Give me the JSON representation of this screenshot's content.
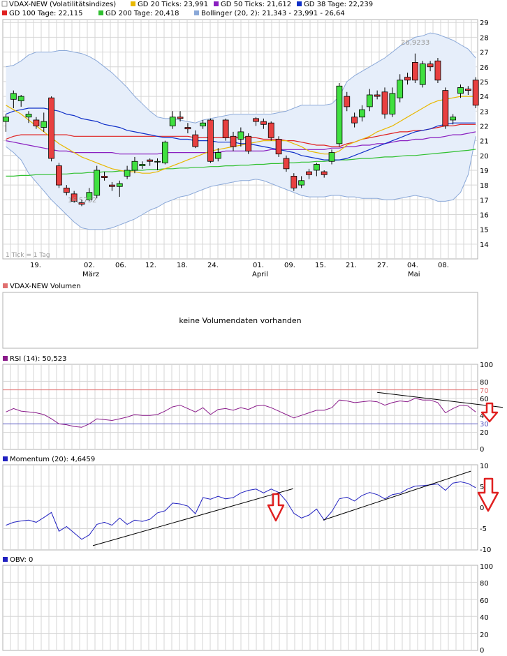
{
  "colors": {
    "ma20": "#e8b800",
    "ma50": "#8a1fc0",
    "ma38": "#1030c8",
    "ma100": "#e02020",
    "ma200": "#30c030",
    "bollinger": "#8aa8d8",
    "bollinger_fill": "#e6eefa",
    "up_candle": "#40e040",
    "down_candle": "#e84040",
    "rsi": "#8a1a8a",
    "rsi70": "#e07070",
    "rsi30": "#5050c0",
    "momentum": "#2020c0",
    "trend": "#000000",
    "arrow": "#e02020",
    "grid": "#cfcfcf",
    "frame": "#b0b0b0"
  },
  "legend": {
    "row1": [
      {
        "label": "VDAX-NEW (Volatilitätsindizes)",
        "color": "#ffffff"
      },
      {
        "label": "GD 20 Ticks: 23,991",
        "color": "#e8b800"
      },
      {
        "label": "GD 50 Ticks: 21,612",
        "color": "#8a1fc0"
      },
      {
        "label": "GD 38 Tage: 22,239",
        "color": "#1030c8"
      }
    ],
    "row2": [
      {
        "label": "GD 100 Tage: 22,115",
        "color": "#e02020"
      },
      {
        "label": "GD 200 Tage: 20,418",
        "color": "#30c030"
      },
      {
        "label": "Bollinger (20, 2): 21,343 - 23,991 - 26,64",
        "color": "#8aa8d8"
      }
    ]
  },
  "tick_note": "1 Tick = 1 Tag",
  "x_axis": {
    "day_labels": [
      "19.",
      "02.",
      "06.",
      "12.",
      "18.",
      "24.",
      "01.",
      "09.",
      "15.",
      "21.",
      "27.",
      "04.",
      "08."
    ],
    "month_labels": [
      "März",
      "April",
      "Mai"
    ]
  },
  "volume_panel": {
    "title": "VDAX-NEW Volumen",
    "message": "keine Volumendaten vorhanden"
  },
  "rsi_panel": {
    "title": "RSI (14): 50,523",
    "y_ticks": [
      "100",
      "80",
      "70",
      "60",
      "40",
      "30",
      "20",
      "0"
    ]
  },
  "momentum_panel": {
    "title": "Momentum (20): 4,6459",
    "y_ticks": [
      "10",
      "5",
      "0",
      "-5",
      "-10"
    ]
  },
  "obv_panel": {
    "title": "OBV: 0",
    "y_ticks": [
      "100",
      "80",
      "60",
      "40",
      "20",
      "0"
    ]
  },
  "chart_data": {
    "type": "candlestick",
    "main": {
      "ylim": [
        13,
        29.2
      ],
      "y_ticks": [
        14,
        15,
        16,
        17,
        18,
        19,
        20,
        21,
        22,
        23,
        24,
        25,
        26,
        27,
        28,
        29
      ],
      "annotations": [
        {
          "text": "26,9233",
          "value": 26.9233,
          "at_index": 49
        },
        {
          "text": "16,5732",
          "value": 16.5732,
          "at_index": 9
        }
      ],
      "candles": [
        [
          22.3,
          22.6,
          21.6,
          22.8
        ],
        [
          23.8,
          24.2,
          23.2,
          24.4
        ],
        [
          23.7,
          24.0,
          23.3,
          24.1
        ],
        [
          22.6,
          22.8,
          22.2,
          23.0
        ],
        [
          22.4,
          22.0,
          21.8,
          22.6
        ],
        [
          21.9,
          22.3,
          21.6,
          22.9
        ],
        [
          23.9,
          19.8,
          19.6,
          24.0
        ],
        [
          19.3,
          18.0,
          17.8,
          19.5
        ],
        [
          17.8,
          17.5,
          17.3,
          18.0
        ],
        [
          17.4,
          16.9,
          16.8,
          17.6
        ],
        [
          16.8,
          16.7,
          16.57,
          17.0
        ],
        [
          17.0,
          17.5,
          16.9,
          17.8
        ],
        [
          17.3,
          19.0,
          17.1,
          19.3
        ],
        [
          18.6,
          18.5,
          18.3,
          18.9
        ],
        [
          18.0,
          17.9,
          17.6,
          18.2
        ],
        [
          17.9,
          18.1,
          17.2,
          18.3
        ],
        [
          18.6,
          19.0,
          18.4,
          19.3
        ],
        [
          19.0,
          19.6,
          18.8,
          19.9
        ],
        [
          19.3,
          19.4,
          19.1,
          19.6
        ],
        [
          19.7,
          19.6,
          19.3,
          19.8
        ],
        [
          19.6,
          19.6,
          19.0,
          19.8
        ],
        [
          19.5,
          20.9,
          19.4,
          21.0
        ],
        [
          22.0,
          22.6,
          21.8,
          23.0
        ],
        [
          22.6,
          22.5,
          22.3,
          23.0
        ],
        [
          21.9,
          21.8,
          21.5,
          22.2
        ],
        [
          21.4,
          20.6,
          20.5,
          21.7
        ],
        [
          22.0,
          22.2,
          21.8,
          22.4
        ],
        [
          22.4,
          19.6,
          19.5,
          22.5
        ],
        [
          19.8,
          20.2,
          19.6,
          20.5
        ],
        [
          22.4,
          21.2,
          21.0,
          22.5
        ],
        [
          21.3,
          20.6,
          20.3,
          21.6
        ],
        [
          21.1,
          21.6,
          20.6,
          21.9
        ],
        [
          21.3,
          20.3,
          20.1,
          21.5
        ],
        [
          22.5,
          22.3,
          22.0,
          22.6
        ],
        [
          22.3,
          22.1,
          21.8,
          22.5
        ],
        [
          22.2,
          21.2,
          21.0,
          22.3
        ],
        [
          21.1,
          20.1,
          19.9,
          21.3
        ],
        [
          19.8,
          19.1,
          18.9,
          20.0
        ],
        [
          18.6,
          17.8,
          17.6,
          18.8
        ],
        [
          18.0,
          18.3,
          17.8,
          18.6
        ],
        [
          18.9,
          18.7,
          18.4,
          19.1
        ],
        [
          19.0,
          19.4,
          18.6,
          19.5
        ],
        [
          18.9,
          18.7,
          18.5,
          19.0
        ],
        [
          19.6,
          20.2,
          19.4,
          20.4
        ],
        [
          20.8,
          24.7,
          20.6,
          24.9
        ],
        [
          24.0,
          23.3,
          23.0,
          24.3
        ],
        [
          22.6,
          22.2,
          21.9,
          22.9
        ],
        [
          22.6,
          23.1,
          22.3,
          23.4
        ],
        [
          23.3,
          24.1,
          23.0,
          24.5
        ],
        [
          24.1,
          24.0,
          23.8,
          24.4
        ],
        [
          24.3,
          22.8,
          22.5,
          24.6
        ],
        [
          22.8,
          24.2,
          22.6,
          24.6
        ],
        [
          23.9,
          25.1,
          23.6,
          25.5
        ],
        [
          25.3,
          25.1,
          24.8,
          25.6
        ],
        [
          26.3,
          25.1,
          24.9,
          26.9
        ],
        [
          24.8,
          26.2,
          24.6,
          26.4
        ],
        [
          26.2,
          26.0,
          25.7,
          26.4
        ],
        [
          26.4,
          25.1,
          24.9,
          26.6
        ],
        [
          24.4,
          22.0,
          21.8,
          24.6
        ],
        [
          22.4,
          22.6,
          22.1,
          22.8
        ],
        [
          24.2,
          24.6,
          23.9,
          24.8
        ],
        [
          24.5,
          24.4,
          24.1,
          24.7
        ],
        [
          25.1,
          23.4,
          23.2,
          25.3
        ]
      ],
      "series": [
        {
          "name": "GD 20 Ticks",
          "values": [
            23.4,
            23.1,
            22.8,
            22.4,
            22.0,
            21.6,
            21.2,
            20.8,
            20.5,
            20.2,
            19.9,
            19.7,
            19.5,
            19.3,
            19.1,
            19.0,
            18.9,
            18.9,
            18.8,
            18.8,
            18.9,
            19.1,
            19.3,
            19.5,
            19.7,
            19.9,
            20.1,
            20.3,
            20.4,
            20.5,
            20.6,
            20.7,
            20.8,
            20.9,
            21.0,
            21.0,
            21.0,
            21.0,
            20.8,
            20.6,
            20.3,
            20.2,
            20.1,
            20.1,
            20.3,
            20.7,
            20.9,
            21.1,
            21.3,
            21.6,
            21.8,
            22.0,
            22.3,
            22.6,
            22.9,
            23.2,
            23.5,
            23.7,
            23.8,
            23.9,
            24.0,
            24.0,
            24.0
          ]
        },
        {
          "name": "GD 50 Ticks",
          "values": [
            21.0,
            20.9,
            20.8,
            20.7,
            20.6,
            20.5,
            20.4,
            20.3,
            20.3,
            20.2,
            20.2,
            20.2,
            20.2,
            20.2,
            20.2,
            20.1,
            20.1,
            20.1,
            20.1,
            20.1,
            20.1,
            20.2,
            20.2,
            20.2,
            20.2,
            20.2,
            20.2,
            20.2,
            20.2,
            20.3,
            20.3,
            20.3,
            20.3,
            20.3,
            20.3,
            20.4,
            20.4,
            20.4,
            20.4,
            20.4,
            20.4,
            20.4,
            20.4,
            20.5,
            20.5,
            20.6,
            20.6,
            20.7,
            20.7,
            20.8,
            20.8,
            20.9,
            21.0,
            21.0,
            21.1,
            21.1,
            21.2,
            21.2,
            21.3,
            21.4,
            21.4,
            21.5,
            21.6
          ]
        },
        {
          "name": "GD 38 Tage",
          "values": [
            22.8,
            23.0,
            23.1,
            23.2,
            23.2,
            23.2,
            23.1,
            23.0,
            22.8,
            22.7,
            22.5,
            22.4,
            22.3,
            22.1,
            22.0,
            21.9,
            21.7,
            21.6,
            21.5,
            21.4,
            21.3,
            21.2,
            21.2,
            21.1,
            21.1,
            21.0,
            21.0,
            21.0,
            20.9,
            20.9,
            20.9,
            20.8,
            20.8,
            20.7,
            20.6,
            20.5,
            20.4,
            20.3,
            20.2,
            20.0,
            19.9,
            19.8,
            19.7,
            19.7,
            19.7,
            19.8,
            20.0,
            20.2,
            20.4,
            20.6,
            20.8,
            21.0,
            21.2,
            21.4,
            21.6,
            21.7,
            21.8,
            22.0,
            22.1,
            22.2,
            22.2,
            22.2,
            22.2
          ]
        },
        {
          "name": "GD 100 Tage",
          "values": [
            21.1,
            21.3,
            21.4,
            21.4,
            21.4,
            21.4,
            21.4,
            21.4,
            21.4,
            21.3,
            21.3,
            21.3,
            21.3,
            21.3,
            21.3,
            21.3,
            21.3,
            21.3,
            21.3,
            21.3,
            21.3,
            21.3,
            21.3,
            21.3,
            21.3,
            21.2,
            21.2,
            21.2,
            21.2,
            21.2,
            21.2,
            21.2,
            21.2,
            21.2,
            21.1,
            21.1,
            21.1,
            21.0,
            21.0,
            20.9,
            20.8,
            20.7,
            20.7,
            20.6,
            20.6,
            20.8,
            20.9,
            21.1,
            21.2,
            21.3,
            21.4,
            21.5,
            21.6,
            21.6,
            21.7,
            21.7,
            21.8,
            21.9,
            22.0,
            22.0,
            22.1,
            22.1,
            22.1
          ]
        },
        {
          "name": "GD 200 Tage",
          "values": [
            18.6,
            18.6,
            18.65,
            18.65,
            18.7,
            18.7,
            18.7,
            18.75,
            18.75,
            18.8,
            18.8,
            18.85,
            18.85,
            18.9,
            18.9,
            18.95,
            18.95,
            19.0,
            19.0,
            19.05,
            19.05,
            19.1,
            19.1,
            19.15,
            19.15,
            19.2,
            19.2,
            19.25,
            19.25,
            19.3,
            19.3,
            19.35,
            19.35,
            19.4,
            19.4,
            19.45,
            19.45,
            19.5,
            19.5,
            19.55,
            19.55,
            19.6,
            19.6,
            19.65,
            19.7,
            19.7,
            19.75,
            19.8,
            19.8,
            19.85,
            19.9,
            19.9,
            19.95,
            20.0,
            20.0,
            20.05,
            20.1,
            20.15,
            20.2,
            20.25,
            20.3,
            20.35,
            20.42
          ]
        },
        {
          "name": "Bollinger upper",
          "values": [
            26.0,
            26.1,
            26.4,
            26.8,
            27.0,
            27.0,
            27.0,
            27.1,
            27.1,
            27.0,
            26.9,
            26.7,
            26.4,
            26.0,
            25.6,
            25.1,
            24.6,
            24.0,
            23.5,
            23.0,
            22.6,
            22.5,
            22.5,
            22.4,
            22.3,
            22.2,
            22.4,
            22.5,
            22.6,
            22.7,
            22.8,
            22.8,
            22.8,
            22.8,
            22.8,
            22.8,
            22.9,
            23.0,
            23.2,
            23.4,
            23.4,
            23.4,
            23.4,
            23.5,
            24.0,
            25.0,
            25.4,
            25.7,
            26.0,
            26.3,
            26.6,
            27.0,
            27.4,
            27.7,
            28.0,
            28.1,
            28.3,
            28.2,
            28.0,
            27.8,
            27.5,
            27.2,
            26.6
          ]
        },
        {
          "name": "Bollinger lower",
          "values": [
            20.6,
            20.2,
            19.7,
            18.8,
            18.2,
            17.6,
            17.0,
            16.5,
            16.0,
            15.5,
            15.1,
            15.0,
            15.0,
            15.0,
            15.1,
            15.3,
            15.5,
            15.7,
            16.0,
            16.3,
            16.5,
            16.8,
            17.0,
            17.2,
            17.3,
            17.5,
            17.7,
            17.9,
            18.0,
            18.1,
            18.2,
            18.3,
            18.3,
            18.4,
            18.3,
            18.1,
            17.9,
            17.7,
            17.5,
            17.3,
            17.2,
            17.2,
            17.2,
            17.3,
            17.3,
            17.2,
            17.2,
            17.1,
            17.1,
            17.1,
            17.0,
            17.0,
            17.1,
            17.2,
            17.3,
            17.2,
            17.1,
            16.9,
            16.9,
            17.0,
            17.5,
            18.7,
            21.3
          ]
        }
      ]
    },
    "rsi": {
      "ylim": [
        0,
        100
      ],
      "levels": [
        70,
        30
      ],
      "values": [
        44,
        48,
        45,
        44,
        43,
        41,
        36,
        30,
        29,
        27,
        26,
        30,
        36,
        35,
        34,
        36,
        38,
        41,
        40,
        40,
        41,
        45,
        50,
        52,
        48,
        44,
        49,
        41,
        47,
        48,
        46,
        49,
        47,
        51,
        52,
        49,
        45,
        41,
        37,
        40,
        43,
        46,
        46,
        49,
        58,
        57,
        55,
        56,
        57,
        56,
        52,
        55,
        57,
        56,
        60,
        58,
        58,
        55,
        43,
        48,
        52,
        51,
        44
      ],
      "trendline": [
        [
          49,
          67
        ],
        [
          63,
          51
        ]
      ]
    },
    "momentum": {
      "ylim": [
        -10,
        10
      ],
      "values": [
        -4.2,
        -3.5,
        -3.2,
        -3.0,
        -3.5,
        -2.4,
        -1.2,
        -5.6,
        -4.5,
        -6.0,
        -7.5,
        -6.5,
        -4.0,
        -3.5,
        -4.2,
        -2.5,
        -4.0,
        -3.0,
        -3.3,
        -2.8,
        -1.3,
        -0.8,
        1.0,
        0.8,
        0.3,
        -1.5,
        2.3,
        1.9,
        2.6,
        2.0,
        2.3,
        3.4,
        4.0,
        4.3,
        3.4,
        4.3,
        3.5,
        1.5,
        -1.4,
        -2.5,
        -1.8,
        -0.4,
        -3.0,
        -1.0,
        2.0,
        2.4,
        1.5,
        2.8,
        3.5,
        3.0,
        2.0,
        3.0,
        3.3,
        4.3,
        5.0,
        5.1,
        5.3,
        5.5,
        4.0,
        5.7,
        6.0,
        5.6,
        4.6
      ],
      "trendlines": [
        [
          [
            10,
            -9.0
          ],
          [
            32,
            3.4
          ]
        ],
        [
          [
            38,
            -2.5
          ],
          [
            62,
            8.5
          ]
        ]
      ]
    },
    "obv": {
      "ylim": [
        0,
        100
      ],
      "values": []
    }
  }
}
